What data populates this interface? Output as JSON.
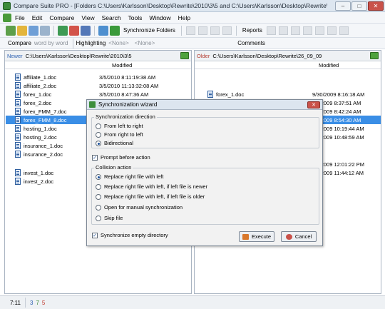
{
  "window": {
    "title": "Compare Suite PRO - [Folders C:\\Users\\Karlsson\\Desktop\\Rewrite\\2010\\3\\5 and C:\\Users\\Karlsson\\Desktop\\Rewrite\\26_09_09]",
    "min": "–",
    "max": "□",
    "close": "✕"
  },
  "menu": [
    "File",
    "Edit",
    "Compare",
    "View",
    "Search",
    "Tools",
    "Window",
    "Help"
  ],
  "toolbar": {
    "sync_label": "Synchronize Folders",
    "reports_label": "Reports",
    "comments_label": "Comments"
  },
  "toolbar2": {
    "compare_label": "Compare",
    "compare_mode": "word by word",
    "highlighting_label": "Highlighting",
    "none1": "<None>",
    "none2": "<None>"
  },
  "left_panel": {
    "tag": "Newer",
    "path": "C:\\Users\\Karlsson\\Desktop\\Rewrite\\2010\\3\\5",
    "modified_header": "Modified",
    "files": [
      {
        "name": "affiliate_1.doc",
        "date": "3/5/2010 8:11:19:38 AM"
      },
      {
        "name": "affiliate_2.doc",
        "date": "3/5/2010 11:13:32:08 AM"
      },
      {
        "name": "forex_1.doc",
        "date": "3/5/2010 8:47:36 AM"
      },
      {
        "name": "forex_2.doc",
        "date": ""
      },
      {
        "name": "forex_FMM_7.doc",
        "date": ""
      },
      {
        "name": "forex_FMM_8.doc",
        "date": ""
      },
      {
        "name": "hosting_1.doc",
        "date": ""
      },
      {
        "name": "hosting_2.doc",
        "date": ""
      },
      {
        "name": "insurance_1.doc",
        "date": ""
      },
      {
        "name": "insurance_2.doc",
        "date": ""
      },
      {
        "name": "invest_1.doc",
        "date": ""
      },
      {
        "name": "invest_2.doc",
        "date": ""
      }
    ]
  },
  "right_panel": {
    "tag": "Older",
    "path": "C:\\Users\\Karlsson\\Desktop\\Rewrite\\26_09_09",
    "modified_header": "Modified",
    "files": [
      {
        "name": "forex_1.doc",
        "date": "9/30/2009 8:16:18 AM"
      },
      {
        "name": "",
        "date": "9/30/2009 8:37:51 AM"
      },
      {
        "name": "",
        "date": "9/30/2009 8:42:24 AM"
      },
      {
        "name": "",
        "date": "9/30/2009 8:54:30 AM"
      },
      {
        "name": "",
        "date": "9/30/2009 10:19:44 AM"
      },
      {
        "name": "",
        "date": "9/30/2009 10:48:59 AM"
      },
      {
        "name": "",
        "date": "9/30/2009 12:01:22 PM"
      },
      {
        "name": "",
        "date": "9/30/2009 11:44:12 AM"
      }
    ]
  },
  "dialog": {
    "title": "Synchronization wizard",
    "direction_label": "Synchronization direction",
    "directions": [
      "From left to right",
      "From right to left",
      "Bidirectional"
    ],
    "prompt_label": "Prompt before action",
    "collision_label": "Collision action",
    "collisions": [
      "Replace right file with left",
      "Replace right file with left, if left file is newer",
      "Replace right file with left, if left file is older",
      "Open for manual synchronization",
      "Skip file"
    ],
    "sync_empty_label": "Synchronize empty directory",
    "execute_label": "Execute",
    "cancel_label": "Cancel"
  },
  "status": {
    "time": "7:11",
    "count_a": "3",
    "count_b": "7",
    "count_c": "5"
  },
  "colors": {
    "accent": "#3a8ee6",
    "green": "#4fa33d",
    "red": "#c9524a"
  }
}
